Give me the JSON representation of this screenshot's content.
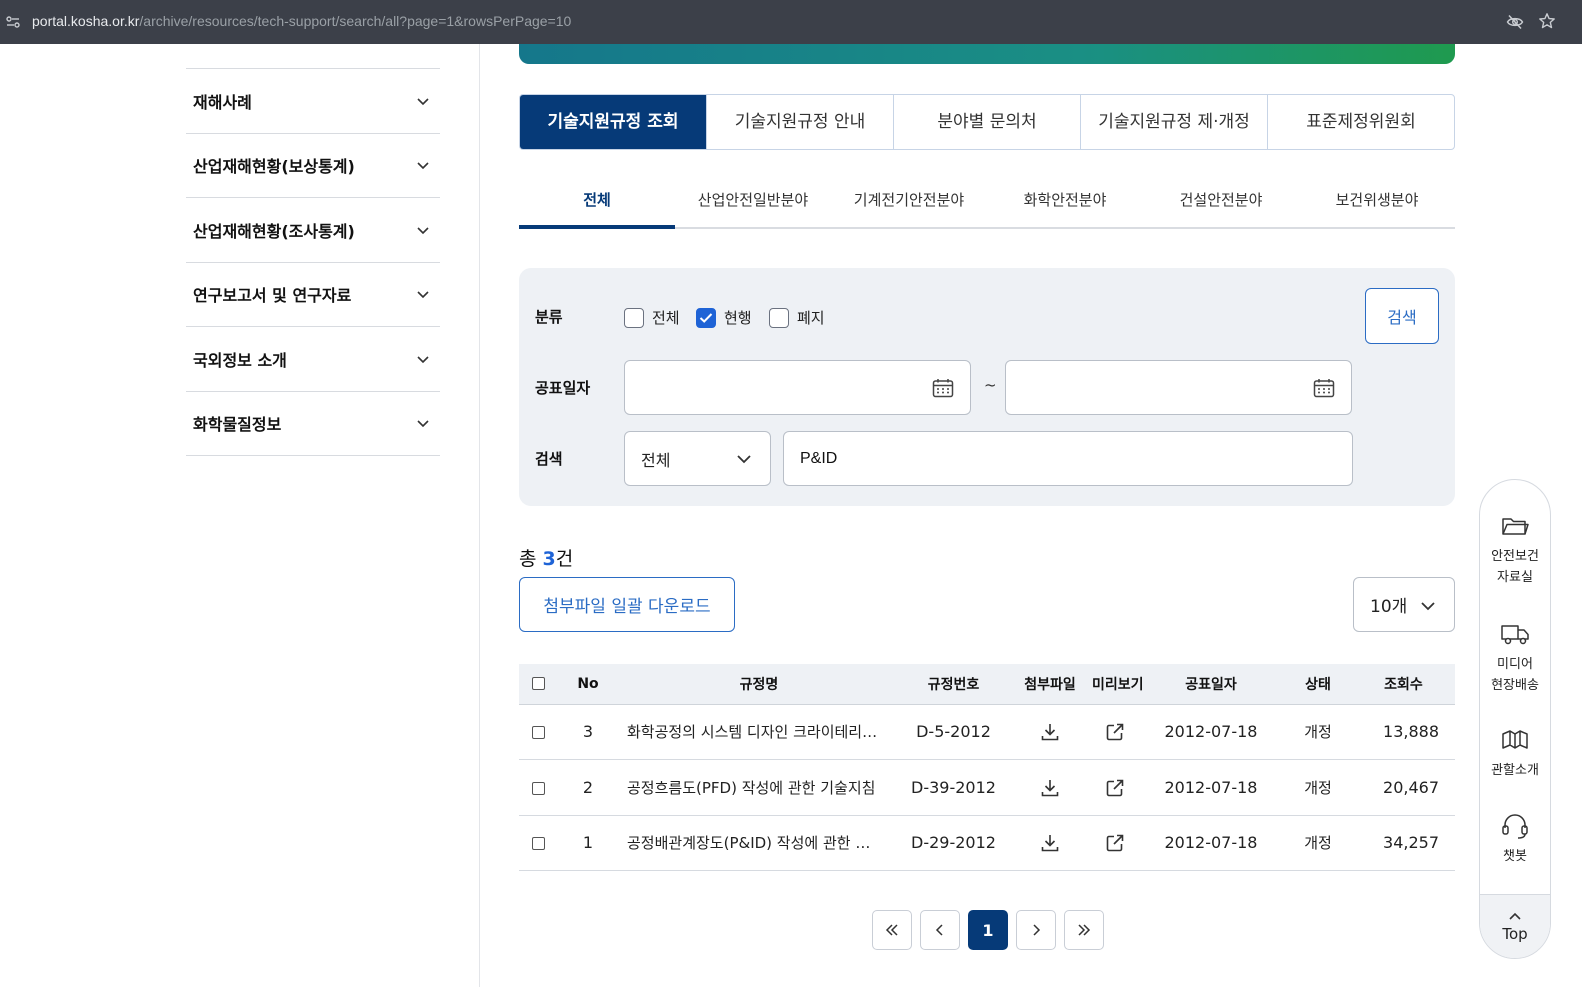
{
  "browser": {
    "url_host": "portal.kosha.or.kr",
    "url_path": "/archive/resources/tech-support/search/all?page=1&rowsPerPage=10"
  },
  "sidebar": {
    "items": [
      {
        "label": "재해사례"
      },
      {
        "label": "산업재해현황(보상통계)"
      },
      {
        "label": "산업재해현황(조사통계)"
      },
      {
        "label": "연구보고서 및 연구자료"
      },
      {
        "label": "국외정보 소개"
      },
      {
        "label": "화학물질정보"
      }
    ]
  },
  "main_tabs": [
    {
      "label": "기술지원규정 조회",
      "active": true
    },
    {
      "label": "기술지원규정 안내"
    },
    {
      "label": "분야별 문의처"
    },
    {
      "label": "기술지원규정 제·개정"
    },
    {
      "label": "표준제정위원회"
    }
  ],
  "sub_tabs": [
    {
      "label": "전체",
      "active": true
    },
    {
      "label": "산업안전일반분야"
    },
    {
      "label": "기계전기안전분야"
    },
    {
      "label": "화학안전분야"
    },
    {
      "label": "건설안전분야"
    },
    {
      "label": "보건위생분야"
    }
  ],
  "filter": {
    "category_label": "분류",
    "options": [
      {
        "label": "전체",
        "checked": false
      },
      {
        "label": "현행",
        "checked": true
      },
      {
        "label": "폐지",
        "checked": false
      }
    ],
    "search_button": "검색",
    "date_label": "공표일자",
    "date_from": "",
    "date_to": "",
    "date_separator": "~",
    "search_label": "검색",
    "search_field_selected": "전체",
    "search_value": "P&ID"
  },
  "results": {
    "total_prefix": "총 ",
    "total_count": "3",
    "total_suffix": "건",
    "bulk_download": "첨부파일 일괄 다운로드",
    "rows_per_page": "10개"
  },
  "table": {
    "headers": [
      "No",
      "규정명",
      "규정번호",
      "첨부파일",
      "미리보기",
      "공표일자",
      "상태",
      "조회수"
    ],
    "rows": [
      {
        "no": "3",
        "name": "화학공정의 시스템 디자인 크라이테리…",
        "code": "D-5-2012",
        "date": "2012-07-18",
        "state": "개정",
        "views": "13,888"
      },
      {
        "no": "2",
        "name": "공정흐름도(PFD) 작성에 관한 기술지침",
        "code": "D-39-2012",
        "date": "2012-07-18",
        "state": "개정",
        "views": "20,467"
      },
      {
        "no": "1",
        "name": "공정배관계장도(P&ID) 작성에 관한 …",
        "code": "D-29-2012",
        "date": "2012-07-18",
        "state": "개정",
        "views": "34,257"
      }
    ]
  },
  "pagination": {
    "current": "1"
  },
  "quick_menu": {
    "items": [
      {
        "label1": "안전보건",
        "label2": "자료실",
        "icon": "folder-icon"
      },
      {
        "label1": "미디어",
        "label2": "현장배송",
        "icon": "truck-icon"
      },
      {
        "label1": "관할소개",
        "label2": "",
        "icon": "map-icon"
      },
      {
        "label1": "챗봇",
        "label2": "",
        "icon": "headset-icon"
      }
    ],
    "top_label": "Top"
  }
}
